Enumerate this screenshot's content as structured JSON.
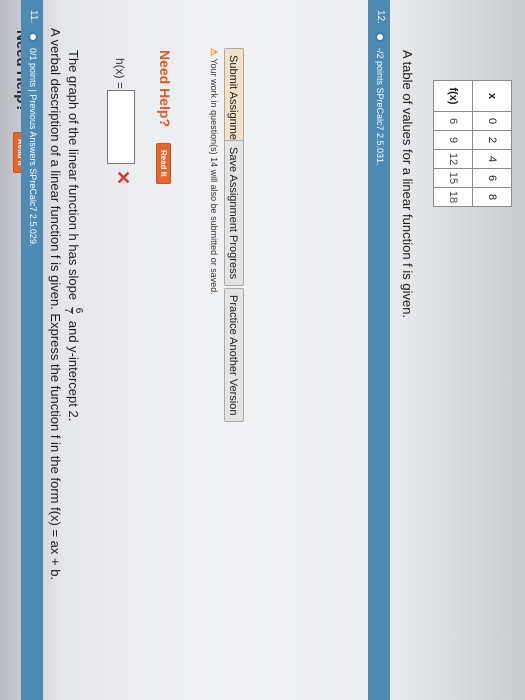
{
  "top": {
    "need_help": "Need Help?",
    "read_it": "Read It"
  },
  "q11": {
    "number": "11.",
    "points": "0/1 points | Previous Answers SPreCalc7 2.5.029.",
    "description": "A verbal description of a linear function f is given. Express the function f in the form f(x) = ax + b.",
    "sub_prefix": "The graph of the linear function h has slope",
    "slope_num": "6",
    "slope_den": "7",
    "sub_suffix": "and y-intercept 2.",
    "answer_label": "h(x) =",
    "answer_value": "",
    "status_mark": "✕",
    "need_help": "Need Help?",
    "read_it": "Read It",
    "warning": "Your work in question(s) 14 will also be submitted or saved.",
    "submit": "Submit Assignment",
    "save": "Save Assignment Progress",
    "practice": "Practice Another Version"
  },
  "q12": {
    "number": "12.",
    "points": "-/2 points SPreCalc7 2.5.031.",
    "description": "A table of values for a linear function f is given.",
    "table": {
      "header": [
        "x",
        "f(x)"
      ],
      "x": [
        "0",
        "2",
        "4",
        "6",
        "8"
      ],
      "fx": [
        "6",
        "9",
        "12",
        "15",
        "18"
      ]
    }
  },
  "colors": {
    "bar": "#4d8bb3",
    "read_it": "#e8652b",
    "error": "#d23a2d"
  }
}
